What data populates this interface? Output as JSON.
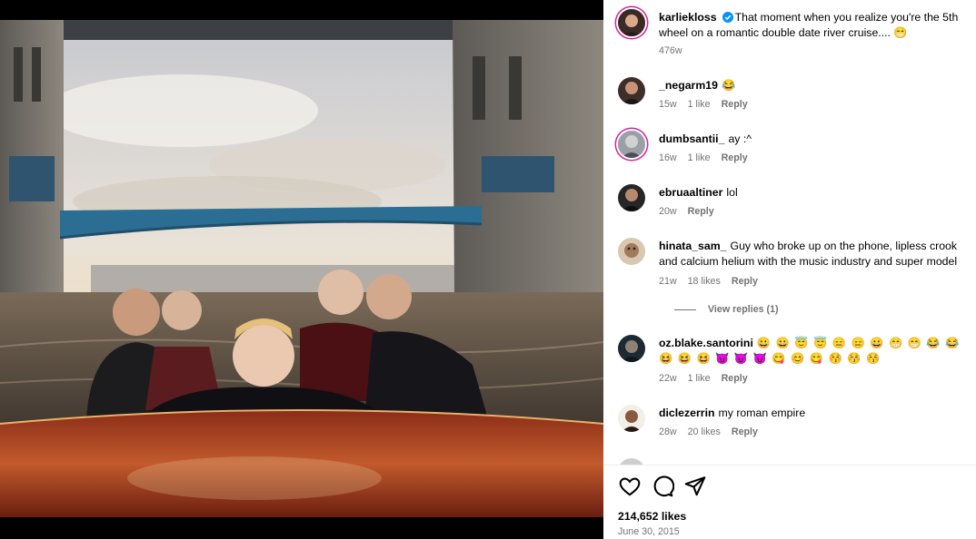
{
  "post": {
    "author": "karliekloss",
    "caption": "That moment when you realize you're the 5th wheel on a romantic double date river cruise.... 😁",
    "age": "476w",
    "likes": "214,652 likes",
    "date": "June 30, 2015"
  },
  "comments": [
    {
      "user": "_negarm19",
      "text": "😂",
      "age": "15w",
      "likes": "1 like",
      "reply": "Reply"
    },
    {
      "user": "dumbsantii_",
      "text": "ay :^",
      "age": "16w",
      "likes": "1 like",
      "reply": "Reply"
    },
    {
      "user": "ebruaaltiner",
      "text": "lol",
      "age": "20w",
      "reply": "Reply"
    },
    {
      "user": "hinata_sam_",
      "text": "Guy who broke up on the phone, lipless crook and calcium helium with the music industry and super model",
      "age": "21w",
      "likes": "18 likes",
      "reply": "Reply",
      "view_replies": "View replies (1)"
    },
    {
      "user": "oz.blake.santorini",
      "text": "😀 😀 😇 😇 😑 😑 😀 😁 😁 😂 😂 😆 😆 😆 😈 😈 😈 😋 😊 😋 😚 😚 😚",
      "age": "22w",
      "likes": "1 like",
      "reply": "Reply"
    },
    {
      "user": "diclezerrin",
      "text": "my roman empire",
      "age": "28w",
      "likes": "20 likes",
      "reply": "Reply"
    }
  ],
  "icons": [
    "heart-icon",
    "comment-icon",
    "share-icon",
    "verified-icon"
  ],
  "colors": {
    "accent": "#0095f6",
    "meta": "#737373",
    "story_ring": "#d6249f"
  }
}
